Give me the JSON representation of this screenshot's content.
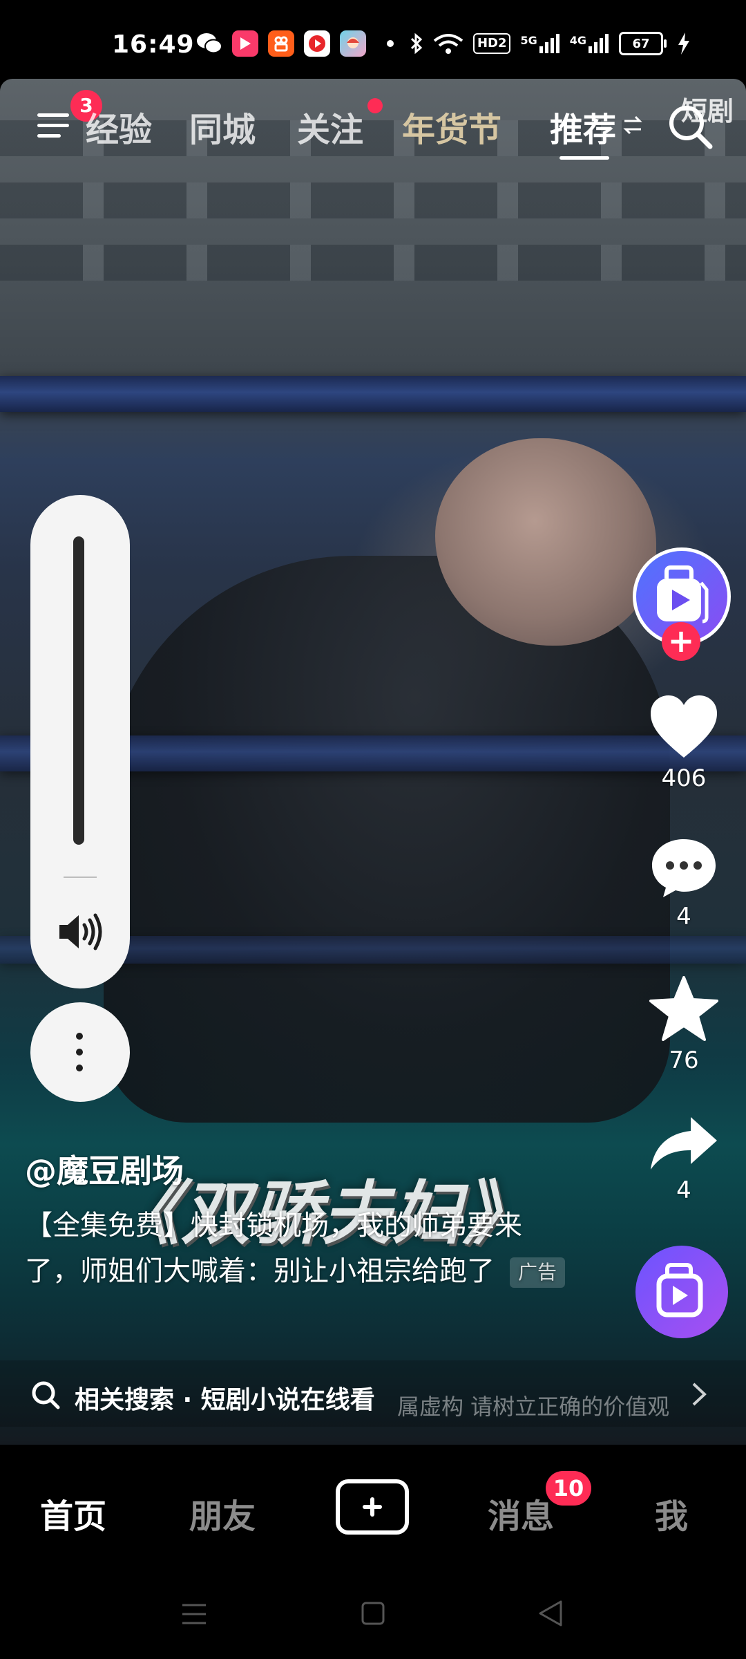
{
  "status_bar": {
    "time": "16:49",
    "network_hd": "HD2",
    "signal_5g": "5G",
    "signal_4g": "4G",
    "battery": "67",
    "icons": [
      "wechat-icon",
      "video-app-icon",
      "kuaishou-icon",
      "red-play-icon",
      "anime-app-icon",
      "dot-icon",
      "bluetooth-icon",
      "wifi-icon",
      "signal-icon",
      "charging-icon"
    ]
  },
  "top_nav": {
    "menu_badge": "3",
    "tabs": [
      {
        "label": "经验"
      },
      {
        "label": "同城"
      },
      {
        "label": "关注"
      },
      {
        "label": "年货节"
      },
      {
        "label": "推荐"
      }
    ],
    "active_tab": "推荐",
    "short_drama_label": "短剧"
  },
  "video": {
    "overlay_title": "《双骄夫妇》",
    "disclaimer": "属虚构 请树立正确的价值观"
  },
  "actions": {
    "likes": "406",
    "comments": "4",
    "favorites": "76",
    "shares": "4"
  },
  "caption": {
    "author": "@魔豆剧场",
    "description": "【全集免费】快封锁机场，我的师弟要来了，师姐们大喊着：别让小祖宗给跑了",
    "ad_tag": "广告"
  },
  "related_search": {
    "label": "相关搜索 · 短剧小说在线看"
  },
  "bottom_nav": {
    "home": "首页",
    "friends": "朋友",
    "messages": "消息",
    "messages_badge": "10",
    "me": "我"
  },
  "colors": {
    "accent_red": "#fe2c55",
    "avatar_blue": "#4e74ff",
    "avatar_purple": "#8a4cf2"
  }
}
